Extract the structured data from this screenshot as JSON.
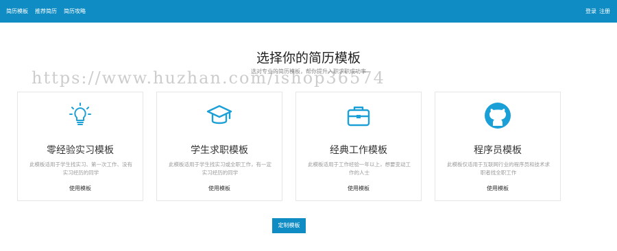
{
  "topbar": {
    "nav": [
      "简历模板",
      "推荐简历",
      "简历攻略"
    ],
    "login": "登录",
    "register": "注册"
  },
  "main": {
    "title": "选择你的简历模板",
    "subtitle": "选对专业的简历模板，帮你提升入职求职成功率",
    "watermark": "https://www.huzhan.com/ishop36574"
  },
  "cards": [
    {
      "title": "零经验实习模板",
      "desc": "此模板适用于学生找实习、第一次工作、没有实习经历的同学",
      "use": "使用模板",
      "icon": "lightbulb-icon"
    },
    {
      "title": "学生求职模板",
      "desc": "此模板适用于学生找实习或全职工作，有一定实习经历的同学",
      "use": "使用模板",
      "icon": "graduation-cap-icon"
    },
    {
      "title": "经典工作模板",
      "desc": "此模板适用于工作经验一年以上，想要变动工作的人士",
      "use": "使用模板",
      "icon": "briefcase-icon"
    },
    {
      "title": "程序员模板",
      "desc": "此模板仅适用于互联网行业的程序员和技术求职者找全职工作",
      "use": "使用模板",
      "icon": "github-icon"
    }
  ],
  "cta": {
    "label": "定制模板"
  },
  "colors": {
    "accent": "#0f8cc3"
  }
}
